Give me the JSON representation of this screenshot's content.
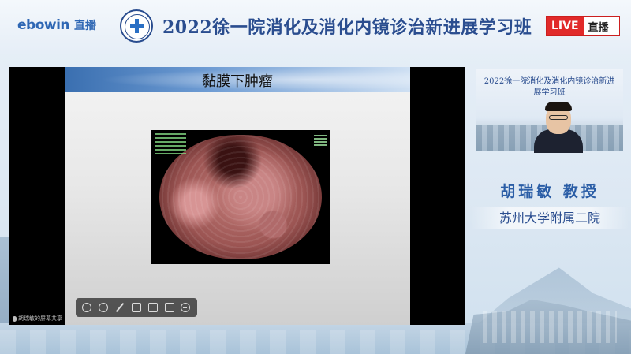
{
  "header": {
    "platform_logo_text": "ebowin",
    "platform_live_cn": "直播",
    "title": "2022徐一院消化及消化内镜诊治新进展学习班",
    "live_badge": "LIVE",
    "live_text": "直播"
  },
  "slide": {
    "title": "黏膜下肿瘤",
    "watermark": "胡瑞敏的屏幕共享"
  },
  "toolbar": {
    "icons": [
      "circle-icon",
      "circle-icon",
      "pen-icon",
      "frame-icon",
      "camera-icon",
      "square-icon",
      "minus-icon"
    ]
  },
  "camera": {
    "background_title": "2022徐一院消化及消化内镜诊治新进展学习班"
  },
  "speaker": {
    "name": "胡瑞敏 教授",
    "affiliation": "苏州大学附属二院"
  },
  "colors": {
    "brand_blue": "#2a4d8f",
    "live_red": "#e12a2a"
  }
}
